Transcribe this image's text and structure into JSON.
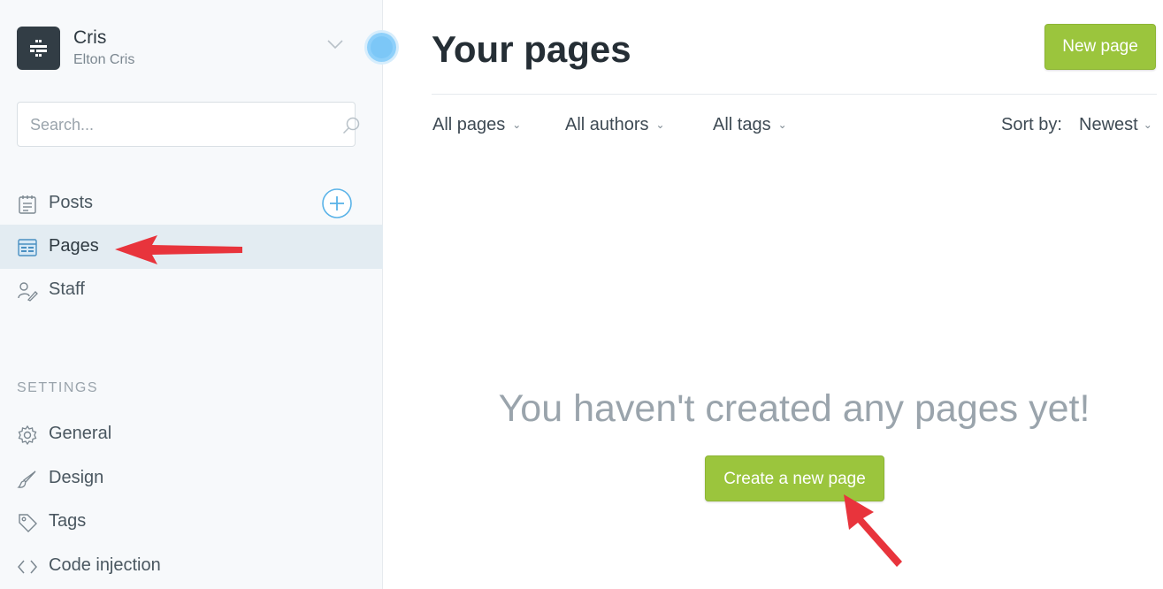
{
  "sidebar": {
    "blog_title": "Cris",
    "blog_user": "Elton Cris",
    "search": {
      "placeholder": "Search..."
    },
    "nav_items": [
      {
        "label": "Posts",
        "icon": "posts-icon"
      },
      {
        "label": "Pages",
        "icon": "pages-icon",
        "active": true
      },
      {
        "label": "Staff",
        "icon": "staff-icon"
      }
    ],
    "settings_heading": "SETTINGS",
    "settings_items": [
      {
        "label": "General",
        "icon": "gear-icon"
      },
      {
        "label": "Design",
        "icon": "brush-icon"
      },
      {
        "label": "Tags",
        "icon": "tag-icon"
      },
      {
        "label": "Code injection",
        "icon": "code-icon"
      }
    ]
  },
  "main": {
    "title": "Your pages",
    "new_page_button": "New page",
    "filters": {
      "type": "All pages",
      "author": "All authors",
      "tag": "All tags"
    },
    "sort": {
      "label": "Sort by:",
      "value": "Newest"
    },
    "empty_state": {
      "message": "You haven't created any pages yet!",
      "button": "Create a new page"
    }
  },
  "colors": {
    "accent_green": "#9bc53d",
    "sidebar_bg": "#f7f9fb",
    "active_item_bg": "#e3ecf2",
    "annotation_arrow": "#e8343c"
  }
}
